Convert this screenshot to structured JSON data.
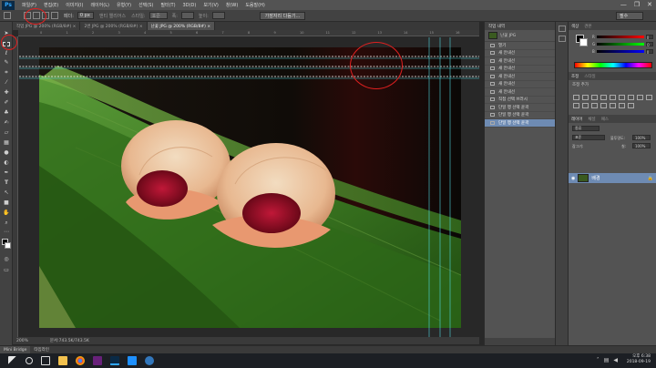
{
  "app": {
    "logo": "Ps"
  },
  "menu": [
    "파일(F)",
    "편집(E)",
    "이미지(I)",
    "레이어(L)",
    "유형(Y)",
    "선택(S)",
    "필터(T)",
    "3D(D)",
    "보기(V)",
    "창(W)",
    "도움말(H)"
  ],
  "window_controls": {
    "minimize": "—",
    "maximize": "❐",
    "close": "✕"
  },
  "options": {
    "feather_label": "페더:",
    "feather_value": "0 px",
    "antialias": "앤티 앨리어스",
    "style_label": "스타일:",
    "style_value": "표준",
    "width_label": "폭:",
    "height_label": "높이:",
    "refine_button": "가장자리 다듬기...",
    "workspace": "필수"
  },
  "tabs": [
    {
      "label": "작업 JPG @ 200% (RGB/8#) ×",
      "active": false
    },
    {
      "label": "2번 JPG @ 200% (RGB/8#) ×",
      "active": false
    },
    {
      "label": "난꽃 JPG @ 200% (RGB/8#) ×",
      "active": true
    }
  ],
  "ruler": {
    "ticks": [
      "0",
      "1",
      "2",
      "3",
      "4",
      "5",
      "6",
      "7",
      "8",
      "9",
      "10",
      "11",
      "12",
      "13",
      "14",
      "15",
      "16"
    ]
  },
  "status": {
    "zoom": "200%",
    "doc": "문서:743.5K/743.5K"
  },
  "minibridge": {
    "tab1": "Mini Bridge",
    "tab2": "타임라인"
  },
  "history": {
    "title": "작업 내역",
    "snapshot": "난꽃 JPG",
    "items": [
      {
        "label": "열기",
        "selected": false
      },
      {
        "label": "새 안내선",
        "selected": false
      },
      {
        "label": "새 안내선",
        "selected": false
      },
      {
        "label": "새 안내선",
        "selected": false
      },
      {
        "label": "새 안내선",
        "selected": false
      },
      {
        "label": "새 안내선",
        "selected": false
      },
      {
        "label": "새 안내선",
        "selected": false
      },
      {
        "label": "직접 선택 브러시",
        "selected": false
      },
      {
        "label": "단일 행 선택 윤곽",
        "selected": false
      },
      {
        "label": "단일 행 선택 윤곽",
        "selected": false
      },
      {
        "label": "단일 행 선택 윤곽",
        "selected": false
      }
    ]
  },
  "color_panel": {
    "tabs": [
      "색상",
      "견본"
    ],
    "channels": [
      {
        "label": "R",
        "value": "0"
      },
      {
        "label": "G",
        "value": "0"
      },
      {
        "label": "B",
        "value": "0"
      }
    ]
  },
  "adjust_panel": {
    "tabs": [
      "조정",
      "스타일"
    ],
    "subtitle": "조정 추가"
  },
  "layers_panel": {
    "tabs": [
      "레이어",
      "채널",
      "패스"
    ],
    "kind_label": "종류",
    "mode": "표준",
    "opacity_label": "불투명도:",
    "opacity_value": "100%",
    "lock_label": "잠그기:",
    "fill_label": "칠:",
    "fill_value": "100%",
    "layer_name": "배경"
  },
  "clock": {
    "time": "오후 6:38",
    "date": "2018-09-19"
  },
  "colors": {
    "accent": "#31a8ff",
    "selection": "#6e8bb3",
    "annotation": "#e02020",
    "guide": "#4fd8e0"
  }
}
